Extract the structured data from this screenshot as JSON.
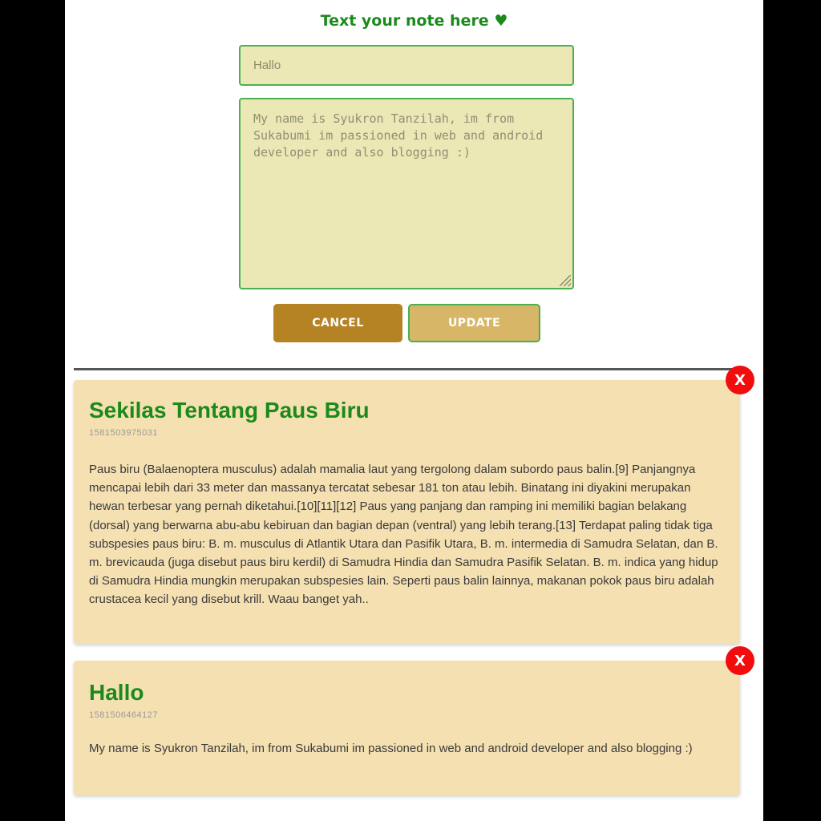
{
  "form": {
    "heading": "Text your note here ♥",
    "title_value": "Hallo",
    "body_value": "My name is Syukron Tanzilah, im from Sukabumi im passioned in web and android developer and also blogging :)",
    "cancel_label": "CANCEL",
    "update_label": "UPDATE"
  },
  "notes": [
    {
      "title": "Sekilas Tentang Paus Biru",
      "id": "1581503975031",
      "body": "Paus biru (Balaenoptera musculus) adalah mamalia laut yang tergolong dalam subordo paus balin.[9] Panjangnya mencapai lebih dari 33 meter dan massanya tercatat sebesar 181 ton atau lebih. Binatang ini diyakini merupakan hewan terbesar yang pernah diketahui.[10][11][12] Paus yang panjang dan ramping ini memiliki bagian belakang (dorsal) yang berwarna abu-abu kebiruan dan bagian depan (ventral) yang lebih terang.[13] Terdapat paling tidak tiga subspesies paus biru: B. m. musculus di Atlantik Utara dan Pasifik Utara, B. m. intermedia di Samudra Selatan, dan B. m. brevicauda (juga disebut paus biru kerdil) di Samudra Hindia dan Samudra Pasifik Selatan. B. m. indica yang hidup di Samudra Hindia mungkin merupakan subspesies lain. Seperti paus balin lainnya, makanan pokok paus biru adalah crustacea kecil yang disebut krill. Waau banget yah..",
      "delete_label": "X"
    },
    {
      "title": "Hallo",
      "id": "1581506464127",
      "body": "My name is Syukron Tanzilah, im from Sukabumi im passioned in web and android developer and also blogging :)",
      "delete_label": "X"
    }
  ],
  "colors": {
    "accent_green": "#1b8a1b",
    "input_bg": "#ebe8b6",
    "card_bg": "#f5e0b2",
    "cancel_bg": "#b58324",
    "update_bg": "#d7b767",
    "delete_bg": "#f10d0d"
  }
}
